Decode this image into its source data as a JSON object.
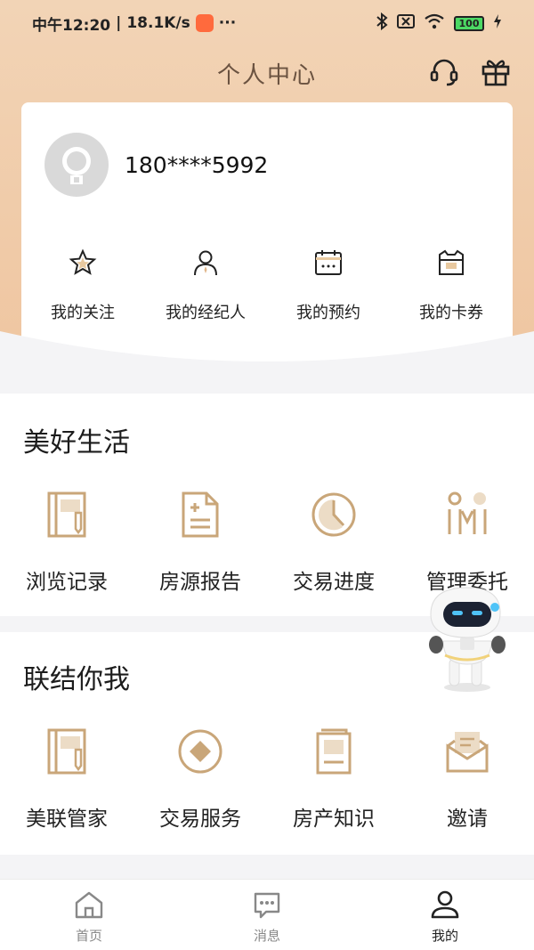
{
  "status_bar": {
    "time": "中午12:20",
    "network_speed": "18.1K/s",
    "more": "···",
    "battery": "100"
  },
  "header": {
    "title": "个人中心",
    "icons": [
      "headset-icon",
      "gift-icon"
    ]
  },
  "profile": {
    "phone": "180****5992",
    "quick_links": [
      {
        "label": "我的关注",
        "icon": "star-icon"
      },
      {
        "label": "我的经纪人",
        "icon": "agent-icon"
      },
      {
        "label": "我的预约",
        "icon": "calendar-icon"
      },
      {
        "label": "我的卡券",
        "icon": "coupon-icon"
      }
    ]
  },
  "sections": [
    {
      "title": "美好生活",
      "items": [
        {
          "label": "浏览记录",
          "icon": "notebook-icon"
        },
        {
          "label": "房源报告",
          "icon": "report-icon"
        },
        {
          "label": "交易进度",
          "icon": "progress-clock-icon"
        },
        {
          "label": "管理委托",
          "icon": "entrust-icon"
        }
      ]
    },
    {
      "title": "联结你我",
      "items": [
        {
          "label": "美联管家",
          "icon": "notebook-icon"
        },
        {
          "label": "交易服务",
          "icon": "service-icon"
        },
        {
          "label": "房产知识",
          "icon": "book-icon"
        },
        {
          "label": "邀请",
          "icon": "invite-envelope-icon"
        }
      ]
    }
  ],
  "bottom_nav": [
    {
      "label": "首页",
      "icon": "home-icon",
      "active": false
    },
    {
      "label": "消息",
      "icon": "message-icon",
      "active": false
    },
    {
      "label": "我的",
      "icon": "profile-icon",
      "active": true
    }
  ],
  "colors": {
    "header_bg": "#efc6a1",
    "title_brown": "#6a5240",
    "icon_gold": "#c9a679"
  }
}
